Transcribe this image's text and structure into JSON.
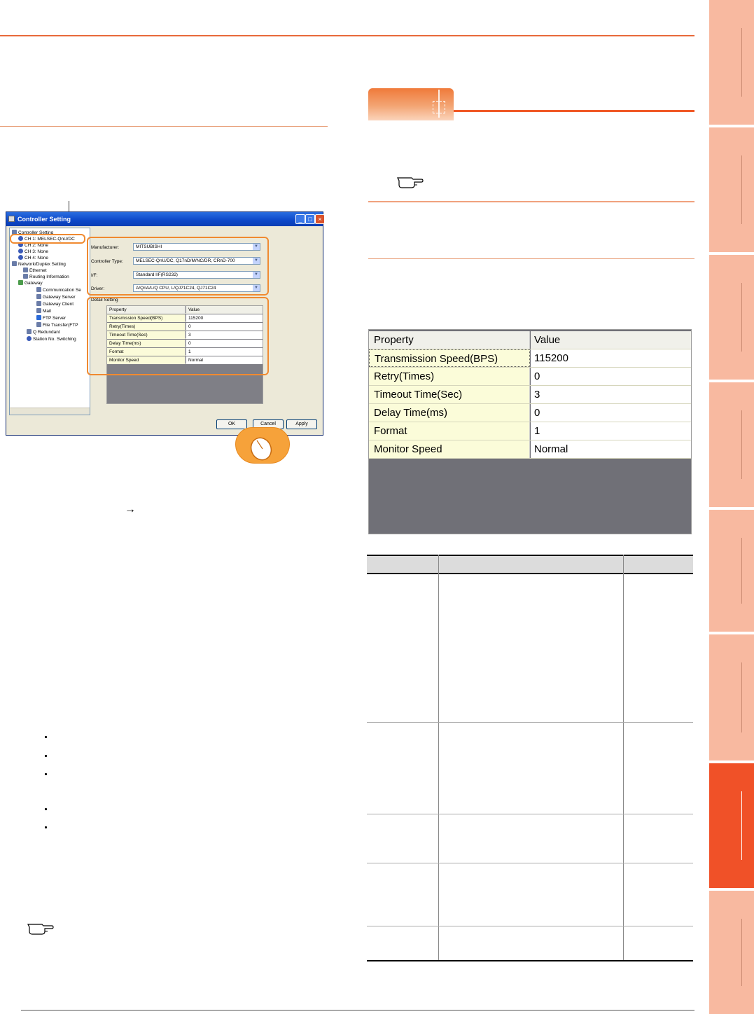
{
  "window": {
    "title": "Controller Setting",
    "tree": [
      "Controller Setting",
      "CH 1: MELSEC-QnU/DC",
      "CH 2: None",
      "CH 3: None",
      "CH 4: None",
      "Network/Duplex Setting",
      "Ethernet",
      "Routing Information",
      "Gateway",
      "Communication Se",
      "Gateway Server",
      "Gateway Client",
      "Mail",
      "FTP Server",
      "File Transfer(FTP",
      "Q Redundant",
      "Station No. Switching"
    ],
    "manufacturer_label": "Manufacturer:",
    "manufacturer_value": "MITSUBISHI",
    "controller_type_label": "Controller Type:",
    "controller_type_value": "MELSEC-QnU/DC, Q17nD/M/NC/DR, CRnD-700",
    "if_label": "I/F:",
    "if_value": "Standard I/F(RS232)",
    "driver_label": "Driver:",
    "driver_value": "A/QnA/L/Q CPU, L/QJ71C24, QJ71C24",
    "detail_setting_label": "Detail Setting",
    "ok_label": "OK",
    "cancel_label": "Cancel",
    "apply_label": "Apply"
  },
  "property_table": {
    "header": {
      "property": "Property",
      "value": "Value"
    },
    "rows": [
      {
        "property": "Transmission Speed(BPS)",
        "value": "115200"
      },
      {
        "property": "Retry(Times)",
        "value": "0"
      },
      {
        "property": "Timeout Time(Sec)",
        "value": "3"
      },
      {
        "property": "Delay Time(ms)",
        "value": "0"
      },
      {
        "property": "Format",
        "value": "1"
      },
      {
        "property": "Monitor Speed",
        "value": "Normal"
      }
    ]
  },
  "colors": {
    "accent": "#f05128",
    "tab": "#f8b9a0",
    "highlight": "#f08a30"
  }
}
